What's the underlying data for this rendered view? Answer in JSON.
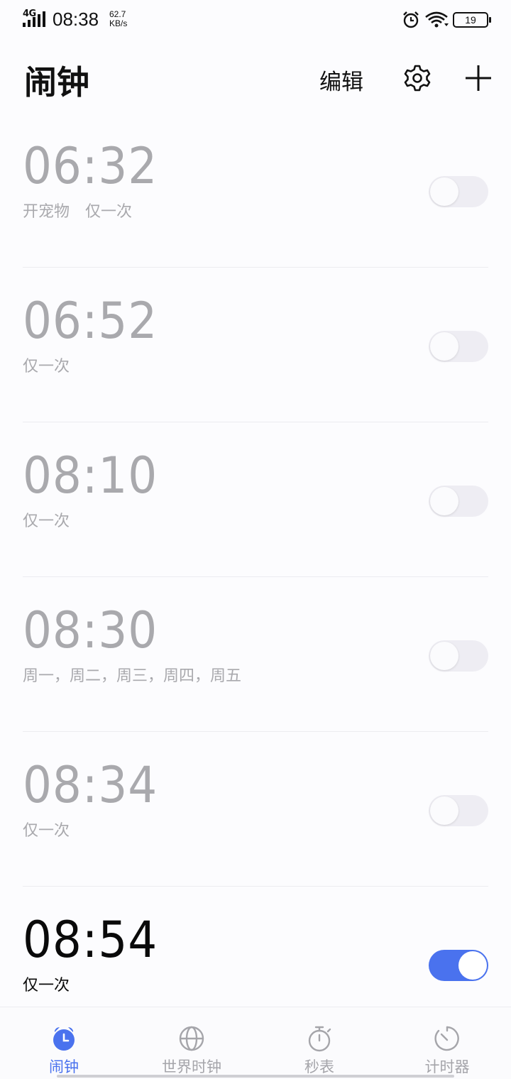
{
  "status_bar": {
    "network_type": "4G",
    "time": "08:38",
    "speed_value": "62.7",
    "speed_unit": "KB/s",
    "battery_level": "19",
    "icons": [
      "signal-icon",
      "alarm-icon",
      "wifi-icon",
      "battery-icon"
    ]
  },
  "header": {
    "title": "闹钟",
    "edit_label": "编辑",
    "settings_icon": "gear-icon",
    "add_icon": "plus-icon"
  },
  "alarms": [
    {
      "time": "06:32",
      "label": "开宠物　仅一次",
      "enabled": false
    },
    {
      "time": "06:52",
      "label": "仅一次",
      "enabled": false
    },
    {
      "time": "08:10",
      "label": "仅一次",
      "enabled": false
    },
    {
      "time": "08:30",
      "label": "周一，周二，周三，周四，周五",
      "enabled": false
    },
    {
      "time": "08:34",
      "label": "仅一次",
      "enabled": false
    },
    {
      "time": "08:54",
      "label": "仅一次",
      "enabled": true
    }
  ],
  "bottom_nav": {
    "active": "闹钟",
    "items": [
      {
        "label": "闹钟",
        "icon": "alarm-clock-icon"
      },
      {
        "label": "世界时钟",
        "icon": "globe-icon"
      },
      {
        "label": "秒表",
        "icon": "stopwatch-icon"
      },
      {
        "label": "计时器",
        "icon": "timer-icon"
      }
    ]
  },
  "colors": {
    "accent": "#4a72ee",
    "inactive_text": "#a9a9ad",
    "active_text": "#0a0a0a",
    "toggle_off": "#eeedf3",
    "background": "#fcfcfe"
  }
}
